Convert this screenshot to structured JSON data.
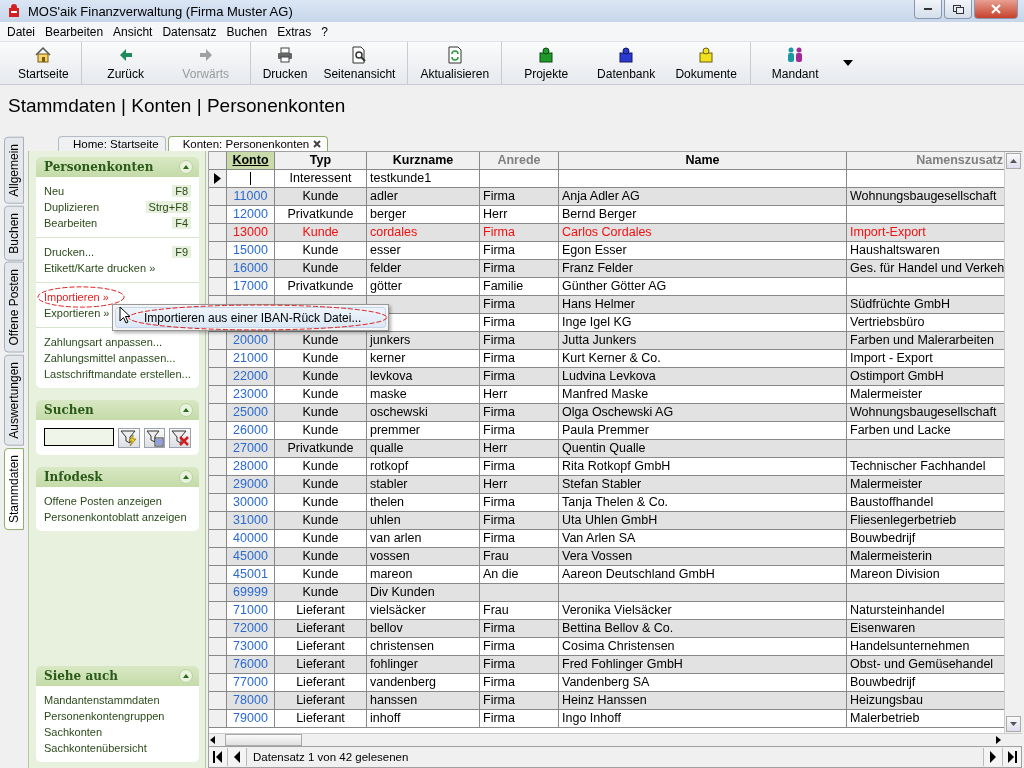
{
  "window": {
    "title": "MOS'aik Finanzverwaltung (Firma Muster AG)"
  },
  "menu": [
    "Datei",
    "Bearbeiten",
    "Ansicht",
    "Datensatz",
    "Buchen",
    "Extras",
    "?"
  ],
  "toolbar": [
    [
      {
        "label": "Startseite",
        "disabled": false
      }
    ],
    [
      {
        "label": "Zurück",
        "disabled": false
      },
      {
        "label": "Vorwärts",
        "disabled": true
      }
    ],
    [
      {
        "label": "Drucken",
        "disabled": false
      },
      {
        "label": "Seitenansicht",
        "disabled": false
      }
    ],
    [
      {
        "label": "Aktualisieren",
        "disabled": false
      }
    ],
    [
      {
        "label": "Projekte",
        "disabled": false
      },
      {
        "label": "Datenbank",
        "disabled": false
      },
      {
        "label": "Dokumente",
        "disabled": false
      }
    ],
    [
      {
        "label": "Mandant",
        "disabled": false
      }
    ]
  ],
  "heading": "Stammdaten | Konten | Personenkonten",
  "side_tabs": [
    {
      "label": "Allgemein",
      "selected": false
    },
    {
      "label": "Buchen",
      "selected": false
    },
    {
      "label": "Offene Posten",
      "selected": false
    },
    {
      "label": "Auswertungen",
      "selected": false
    },
    {
      "label": "Stammdaten",
      "selected": true
    }
  ],
  "doc_tabs": [
    {
      "label": "Home: Startseite",
      "selected": false,
      "closable": false
    },
    {
      "label": "Konten: Personenkonten",
      "selected": true,
      "closable": true
    }
  ],
  "panels": [
    {
      "title": "Personenkonten",
      "kind": "links",
      "groups": [
        [
          {
            "label": "Neu",
            "shortcut": "F8",
            "circled": false
          },
          {
            "label": "Duplizieren",
            "shortcut": "Strg+F8",
            "circled": false
          },
          {
            "label": "Bearbeiten",
            "shortcut": "F4",
            "circled": false
          }
        ],
        [
          {
            "label": "Drucken...",
            "shortcut": "F9",
            "circled": false
          },
          {
            "label": "Etikett/Karte drucken »",
            "circled": false
          }
        ],
        [
          {
            "label": "Importieren »",
            "circled": true
          },
          {
            "label": "Exportieren »",
            "circled": false
          }
        ],
        [
          {
            "label": "Zahlungsart anpassen...",
            "circled": false
          },
          {
            "label": "Zahlungsmittel anpassen...",
            "circled": false
          },
          {
            "label": "Lastschriftmandate erstellen...",
            "circled": false
          }
        ]
      ]
    },
    {
      "title": "Suchen",
      "kind": "search"
    },
    {
      "title": "Infodesk",
      "kind": "links",
      "groups": [
        [
          {
            "label": "Offene Posten anzeigen",
            "circled": false
          },
          {
            "label": "Personenkontoblatt anzeigen",
            "circled": false
          }
        ]
      ]
    },
    {
      "title": "Siehe auch",
      "kind": "links",
      "groups": [
        [
          {
            "label": "Mandantenstammdaten",
            "circled": false
          },
          {
            "label": "Personenkontengruppen",
            "circled": false
          },
          {
            "label": "Sachkonten",
            "circled": false
          },
          {
            "label": "Sachkontenübersicht",
            "circled": false
          }
        ]
      ]
    }
  ],
  "table": {
    "columns": [
      {
        "label": "Konto",
        "selected": true,
        "dimmed": false
      },
      {
        "label": "Typ",
        "selected": false,
        "dimmed": false
      },
      {
        "label": "Kurzname",
        "selected": false,
        "dimmed": false
      },
      {
        "label": "Anrede",
        "selected": false,
        "dimmed": true
      },
      {
        "label": "Name",
        "selected": false,
        "dimmed": false
      },
      {
        "label": "Namenszusatz",
        "selected": false,
        "dimmed": true
      }
    ],
    "rows": [
      {
        "current": true,
        "flagged": false,
        "typ": "Interessent",
        "kurzname": "testkunde1"
      },
      {
        "current": false,
        "flagged": false,
        "konto": "11000",
        "typ": "Kunde",
        "kurzname": "adler",
        "anrede": "Firma",
        "name": "Anja Adler AG",
        "zusatz": "Wohnungsbaugesellschaft"
      },
      {
        "current": false,
        "flagged": false,
        "konto": "12000",
        "typ": "Privatkunde",
        "kurzname": "berger",
        "anrede": "Herr",
        "name": "Bernd Berger"
      },
      {
        "current": false,
        "flagged": true,
        "konto": "13000",
        "typ": "Kunde",
        "kurzname": "cordales",
        "anrede": "Firma",
        "name": "Carlos Cordales",
        "zusatz": "Import-Export"
      },
      {
        "current": false,
        "flagged": false,
        "konto": "15000",
        "typ": "Kunde",
        "kurzname": "esser",
        "anrede": "Firma",
        "name": "Egon Esser",
        "zusatz": "Haushaltswaren"
      },
      {
        "current": false,
        "flagged": false,
        "konto": "16000",
        "typ": "Kunde",
        "kurzname": "felder",
        "anrede": "Firma",
        "name": "Franz Felder",
        "zusatz": "Ges. für Handel und Verkeh"
      },
      {
        "current": false,
        "flagged": false,
        "konto": "17000",
        "typ": "Privatkunde",
        "kurzname": "götter",
        "anrede": "Familie",
        "name": "Günther Götter AG"
      },
      {
        "current": false,
        "flagged": false,
        "anrede": "Firma",
        "name": "Hans Helmer",
        "zusatz": "Südfrüchte GmbH"
      },
      {
        "flagged": false,
        "anrede": "Firma",
        "name": "Inge Igel KG",
        "zusatz": "Vertriebsbüro"
      },
      {
        "current": false,
        "flagged": false,
        "konto": "20000",
        "typ": "Kunde",
        "kurzname": "junkers",
        "anrede": "Firma",
        "name": "Jutta Junkers",
        "zusatz": "Farben und Malerarbeiten"
      },
      {
        "current": false,
        "flagged": false,
        "konto": "21000",
        "typ": "Kunde",
        "kurzname": "kerner",
        "anrede": "Firma",
        "name": "Kurt Kerner & Co.",
        "zusatz": "Import - Export"
      },
      {
        "current": false,
        "flagged": false,
        "konto": "22000",
        "typ": "Kunde",
        "kurzname": "levkova",
        "anrede": "Firma",
        "name": "Ludvina Levkova",
        "zusatz": "Ostimport GmbH"
      },
      {
        "current": false,
        "flagged": false,
        "konto": "23000",
        "typ": "Kunde",
        "kurzname": "maske",
        "anrede": "Herr",
        "name": "Manfred Maske",
        "zusatz": "Malermeister"
      },
      {
        "current": false,
        "flagged": false,
        "konto": "25000",
        "typ": "Kunde",
        "kurzname": "oschewski",
        "anrede": "Firma",
        "name": "Olga Oschewski AG",
        "zusatz": "Wohnungsbaugesellschaft"
      },
      {
        "current": false,
        "flagged": false,
        "konto": "26000",
        "typ": "Kunde",
        "kurzname": "premmer",
        "anrede": "Firma",
        "name": "Paula Premmer",
        "zusatz": "Farben und Lacke"
      },
      {
        "current": false,
        "flagged": false,
        "konto": "27000",
        "typ": "Privatkunde",
        "kurzname": "qualle",
        "anrede": "Herr",
        "name": "Quentin Qualle"
      },
      {
        "current": false,
        "flagged": false,
        "konto": "28000",
        "typ": "Kunde",
        "kurzname": "rotkopf",
        "anrede": "Firma",
        "name": "Rita Rotkopf GmbH",
        "zusatz": "Technischer Fachhandel"
      },
      {
        "current": false,
        "flagged": false,
        "konto": "29000",
        "typ": "Kunde",
        "kurzname": "stabler",
        "anrede": "Herr",
        "name": "Stefan Stabler",
        "zusatz": "Malermeister"
      },
      {
        "current": false,
        "flagged": false,
        "konto": "30000",
        "typ": "Kunde",
        "kurzname": "thelen",
        "anrede": "Firma",
        "name": "Tanja Thelen & Co.",
        "zusatz": "Baustoffhandel"
      },
      {
        "current": false,
        "flagged": false,
        "konto": "31000",
        "typ": "Kunde",
        "kurzname": "uhlen",
        "anrede": "Firma",
        "name": "Uta Uhlen GmbH",
        "zusatz": "Fliesenlegerbetrieb"
      },
      {
        "current": false,
        "flagged": false,
        "konto": "40000",
        "typ": "Kunde",
        "kurzname": "van arlen",
        "anrede": "Firma",
        "name": "Van Arlen SA",
        "zusatz": "Bouwbedrijf"
      },
      {
        "current": false,
        "flagged": false,
        "konto": "45000",
        "typ": "Kunde",
        "kurzname": "vossen",
        "anrede": "Frau",
        "name": "Vera Vossen",
        "zusatz": "Malermeisterin"
      },
      {
        "current": false,
        "flagged": false,
        "konto": "45001",
        "typ": "Kunde",
        "kurzname": "mareon",
        "anrede": "An die",
        "name": "Aareon Deutschland GmbH",
        "zusatz": "Mareon Division"
      },
      {
        "current": false,
        "flagged": false,
        "konto": "69999",
        "typ": "Kunde",
        "kurzname": "Div Kunden"
      },
      {
        "current": false,
        "flagged": false,
        "konto": "71000",
        "typ": "Lieferant",
        "kurzname": "vielsäcker",
        "anrede": "Frau",
        "name": "Veronika Vielsäcker",
        "zusatz": "Natursteinhandel"
      },
      {
        "current": false,
        "flagged": false,
        "konto": "72000",
        "typ": "Lieferant",
        "kurzname": "bellov",
        "anrede": "Firma",
        "name": "Bettina Bellov & Co.",
        "zusatz": "Eisenwaren"
      },
      {
        "current": false,
        "flagged": false,
        "konto": "73000",
        "typ": "Lieferant",
        "kurzname": "christensen",
        "anrede": "Firma",
        "name": "Cosima Christensen",
        "zusatz": "Handelsunternehmen"
      },
      {
        "current": false,
        "flagged": false,
        "konto": "76000",
        "typ": "Lieferant",
        "kurzname": "fohlinger",
        "anrede": "Firma",
        "name": "Fred Fohlinger GmbH",
        "zusatz": "Obst- und Gemüsehandel"
      },
      {
        "current": false,
        "flagged": false,
        "konto": "77000",
        "typ": "Lieferant",
        "kurzname": "vandenberg",
        "anrede": "Firma",
        "name": "Vandenberg SA",
        "zusatz": "Bouwbedrijf"
      },
      {
        "current": false,
        "flagged": false,
        "konto": "78000",
        "typ": "Lieferant",
        "kurzname": "hanssen",
        "anrede": "Firma",
        "name": "Heinz Hanssen",
        "zusatz": "Heizungsbau"
      },
      {
        "current": false,
        "flagged": false,
        "konto": "79000",
        "typ": "Lieferant",
        "kurzname": "inhoff",
        "anrede": "Firma",
        "name": "Ingo Inhoff",
        "zusatz": "Malerbetrieb"
      }
    ]
  },
  "popup": {
    "items": [
      {
        "label": "Importieren aus einer IBAN-Rück Datei...",
        "circled": true
      }
    ]
  },
  "status_bar": {
    "text": "Datensatz 1 von 42 gelesenen"
  }
}
